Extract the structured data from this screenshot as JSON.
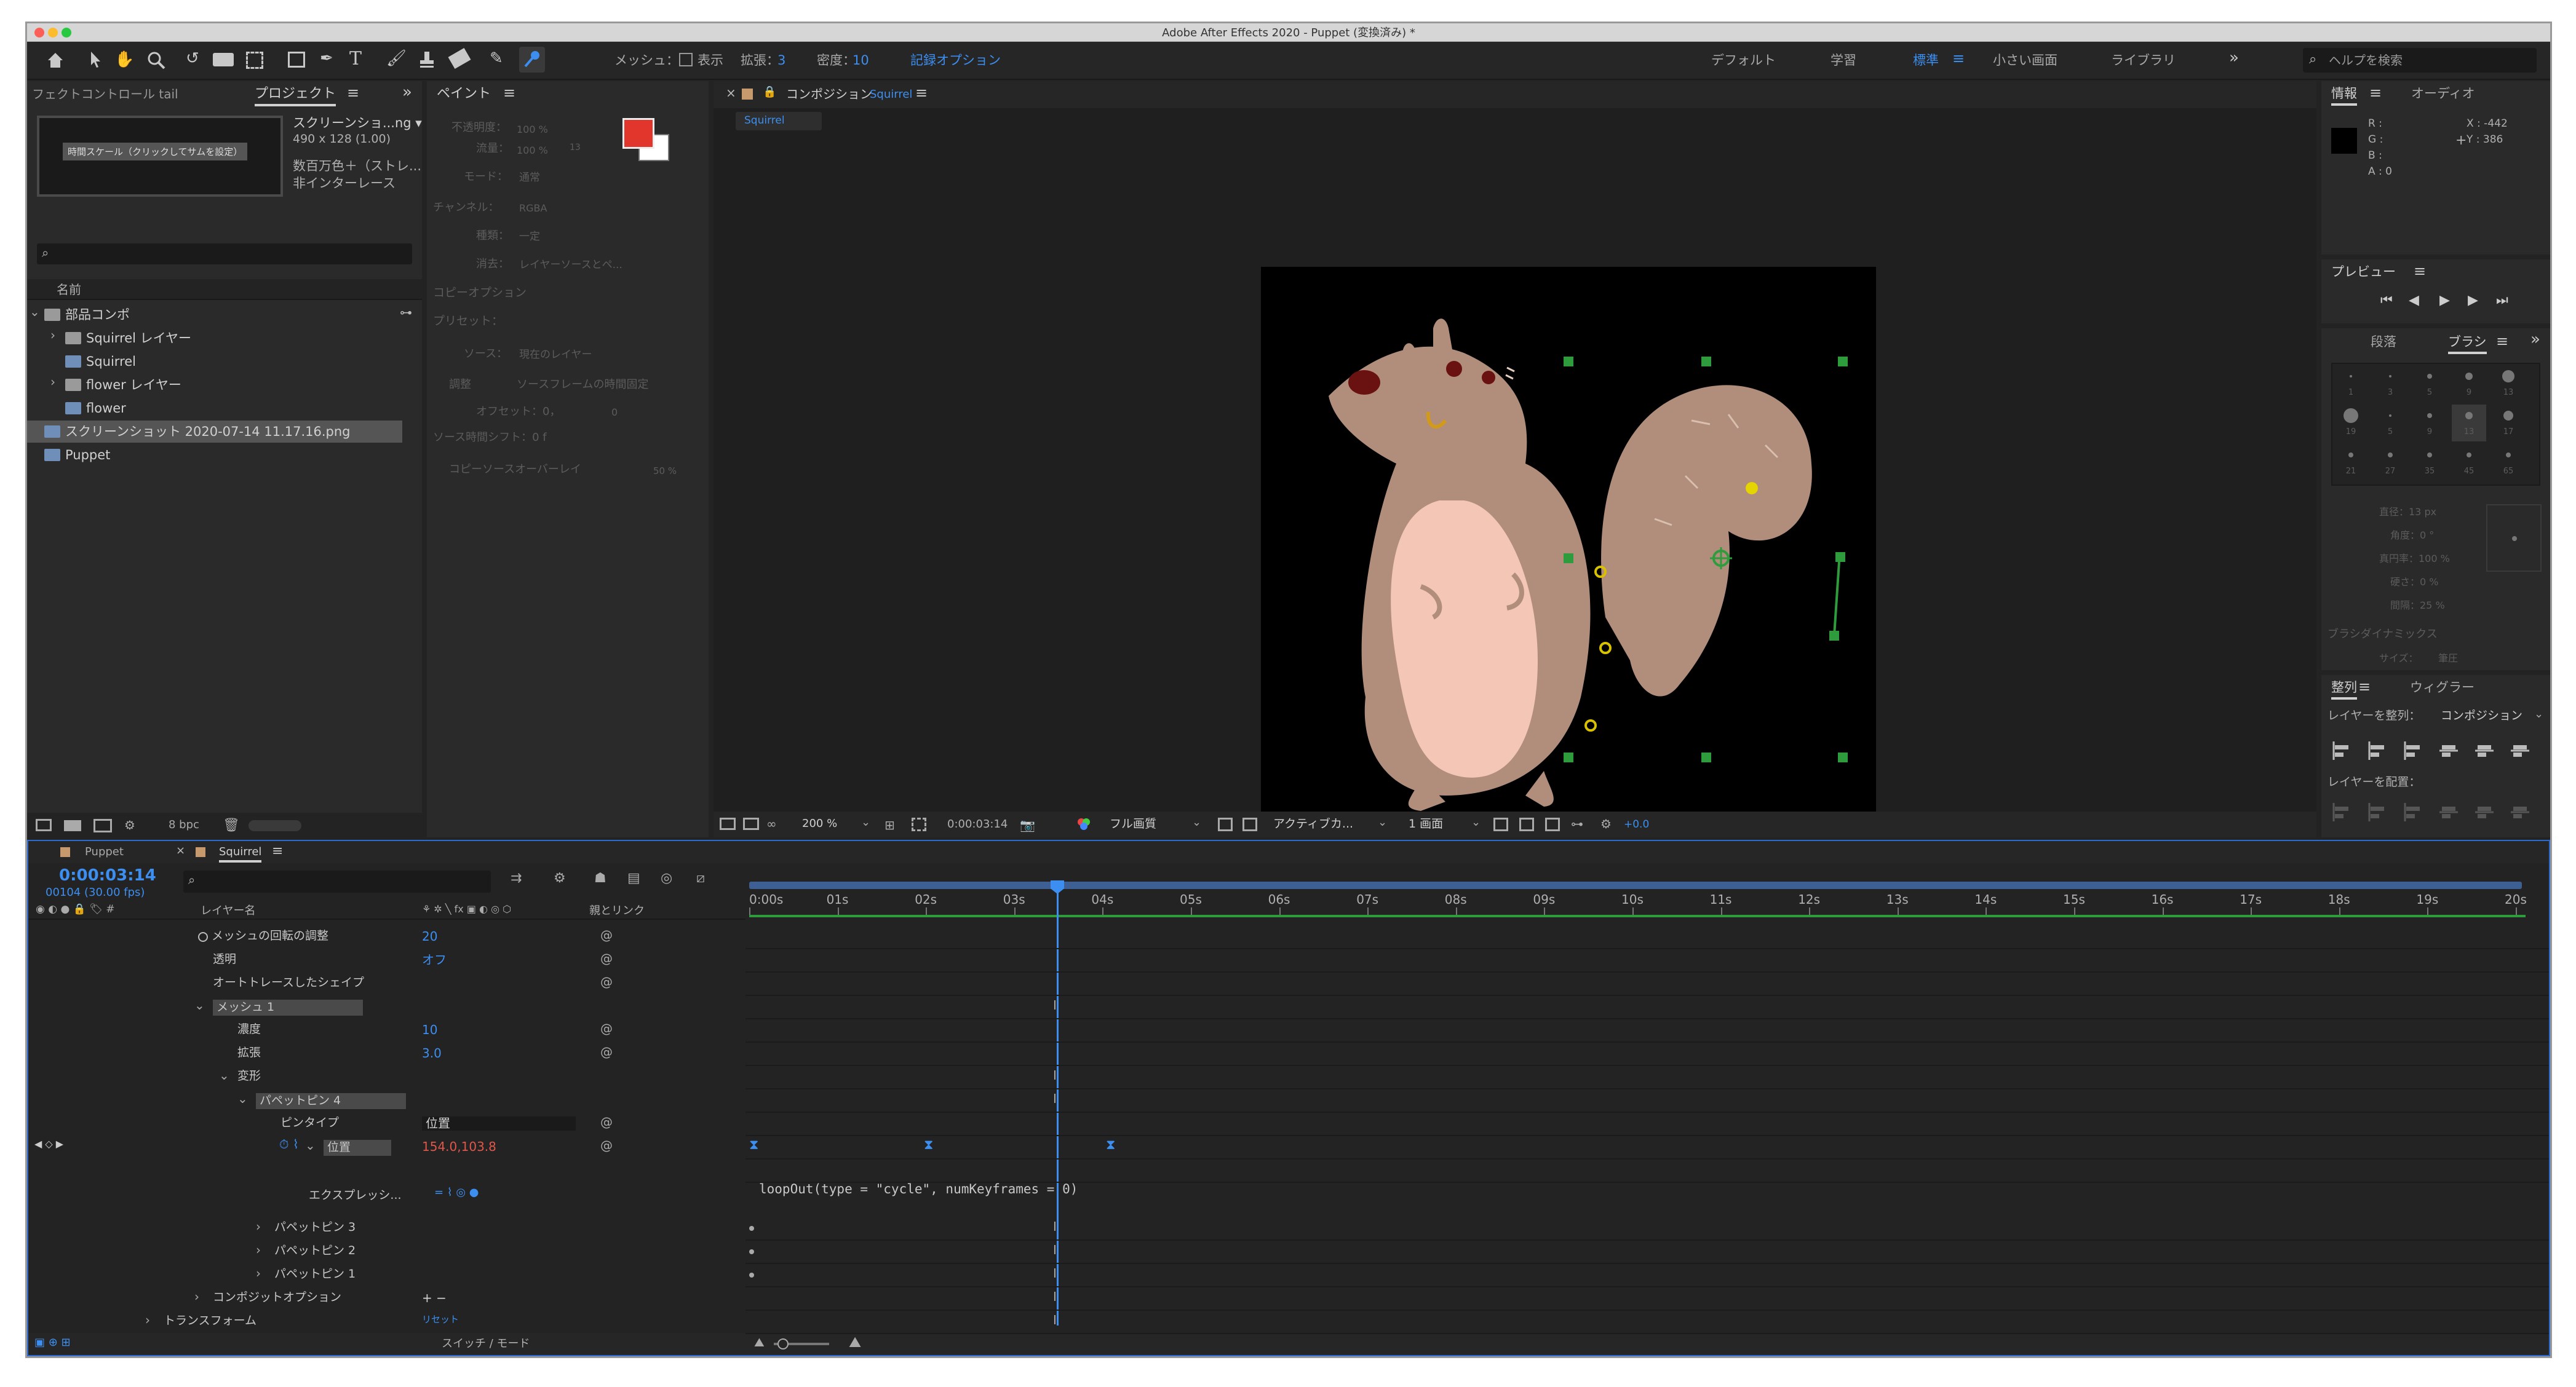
{
  "title": "Adobe After Effects 2020 - Puppet (変換済み) *",
  "toolbar": {
    "mesh_label": "メッシュ：",
    "show": "表示",
    "expand_label": "拡張：",
    "expand_val": "3",
    "density_label": "密度：",
    "density_val": "10",
    "record": "記録オプション",
    "ws": [
      "デフォルト",
      "学習",
      "標準",
      "小さい画面",
      "ライブラリ"
    ],
    "help": "ヘルプを検索"
  },
  "project": {
    "tab_effect": "フェクトコントロール tail",
    "tab_project": "プロジェクト",
    "thumb_btn": "時間スケール（クリックしてサムを設定）",
    "file_name": "スクリーンショ...ng ▾",
    "file_size": "490 x 128 (1.00)",
    "file_color": "数百万色＋（ストレ...",
    "file_interlace": "非インターレース",
    "col_name": "名前",
    "items": [
      "部品コンポ",
      "Squirrel レイヤー",
      "Squirrel",
      "flower レイヤー",
      "flower",
      "スクリーンショット 2020-07-14 11.17.16.png",
      "Puppet"
    ],
    "bpc": "8 bpc"
  },
  "paint": {
    "tab": "ペイント",
    "labels": [
      "不透明度：",
      "流量：",
      "モード：",
      "チャンネル：",
      "種類：",
      "消去："
    ],
    "vals": [
      "100 %",
      "100 %",
      "通常",
      "RGBA",
      "一定",
      "レイヤーソースとペ..."
    ],
    "clone": "コピーオプション",
    "preset": "プリセット：",
    "source": "ソース：",
    "source_val": "現在のレイヤー",
    "align": "調整",
    "lock": "ソースフレームの時間固定",
    "offset": "オフセット：0，",
    "offset2": "0",
    "shift": "ソース時間シフト：0 f",
    "overlay": "コピーソースオーバーレイ",
    "overlay_val": "50 %",
    "n13": "13"
  },
  "comp": {
    "tab_label": "コンポジション",
    "tab_name": "Squirrel",
    "sub": "Squirrel",
    "zoom": "200 %",
    "time": "0:00:03:14",
    "quality": "フル画質",
    "camera": "アクティブカ...",
    "views": "1 画面",
    "exposure": "+0.0"
  },
  "info": {
    "tab": "情報",
    "tab2": "オーディオ",
    "r": "R :",
    "g": "G :",
    "b": "B :",
    "a": "A : 0",
    "x": "X : -442",
    "y": "Y : 386"
  },
  "preview": {
    "tab": "プレビュー"
  },
  "brush": {
    "tab1": "段落",
    "tab2": "ブラシ",
    "sizes": [
      "1",
      "3",
      "5",
      "9",
      "13",
      "19",
      "5",
      "9",
      "13",
      "17",
      "21",
      "27",
      "35",
      "45",
      "65"
    ],
    "diameter": "直径：13 px",
    "angle": "角度：0 °",
    "round": "真円率：100 %",
    "hard": "硬さ：0 %",
    "spacing": "間隔：25 %",
    "dyn": "ブラシダイナミックス",
    "size": "サイズ：",
    "size_val": "筆圧"
  },
  "align": {
    "tab": "整列",
    "tab2": "ウィグラー",
    "align_to": "レイヤーを整列：",
    "align_target": "コンポジション",
    "distribute": "レイヤーを配置："
  },
  "timeline": {
    "tab1": "Puppet",
    "tab2": "Squirrel",
    "time": "0:00:03:14",
    "frames": "00104 (30.00 fps)",
    "col_layer": "レイヤー名",
    "col_parent": "親とリンク",
    "footer": "スイッチ / モード",
    "ticks": [
      "0:00s",
      "01s",
      "02s",
      "03s",
      "04s",
      "05s",
      "06s",
      "07s",
      "08s",
      "09s",
      "10s",
      "11s",
      "12s",
      "13s",
      "14s",
      "15s",
      "16s",
      "17s",
      "18s",
      "19s",
      "20s"
    ],
    "rows": [
      {
        "label": "メッシュの回転の調整",
        "value": "20"
      },
      {
        "label": "透明",
        "value": "オフ"
      },
      {
        "label": "オートトレースしたシェイプ",
        "value": ""
      },
      {
        "label": "メッシュ 1",
        "value": ""
      },
      {
        "label": "濃度",
        "value": "10"
      },
      {
        "label": "拡張",
        "value": "3.0"
      },
      {
        "label": "変形",
        "value": ""
      },
      {
        "label": "パペットピン 4",
        "value": ""
      },
      {
        "label": "ピンタイプ",
        "value": "位置"
      },
      {
        "label": "位置",
        "value": "154.0,103.8"
      },
      {
        "label": "エクスプレッシ...",
        "value": ""
      },
      {
        "label": "パペットピン 3",
        "value": ""
      },
      {
        "label": "パペットピン 2",
        "value": ""
      },
      {
        "label": "パペットピン 1",
        "value": ""
      },
      {
        "label": "コンポジットオプション",
        "value": "+ −"
      },
      {
        "label": "トランスフォーム",
        "value": "リセット"
      }
    ],
    "expression": "loopOut(type = \"cycle\", numKeyframes = 0)"
  },
  "colors": {
    "accent": "#3c8ff0",
    "fg": "#e2352b",
    "pin": "#d8c100",
    "handle": "#2e9c3c",
    "value": "#e0574a"
  }
}
